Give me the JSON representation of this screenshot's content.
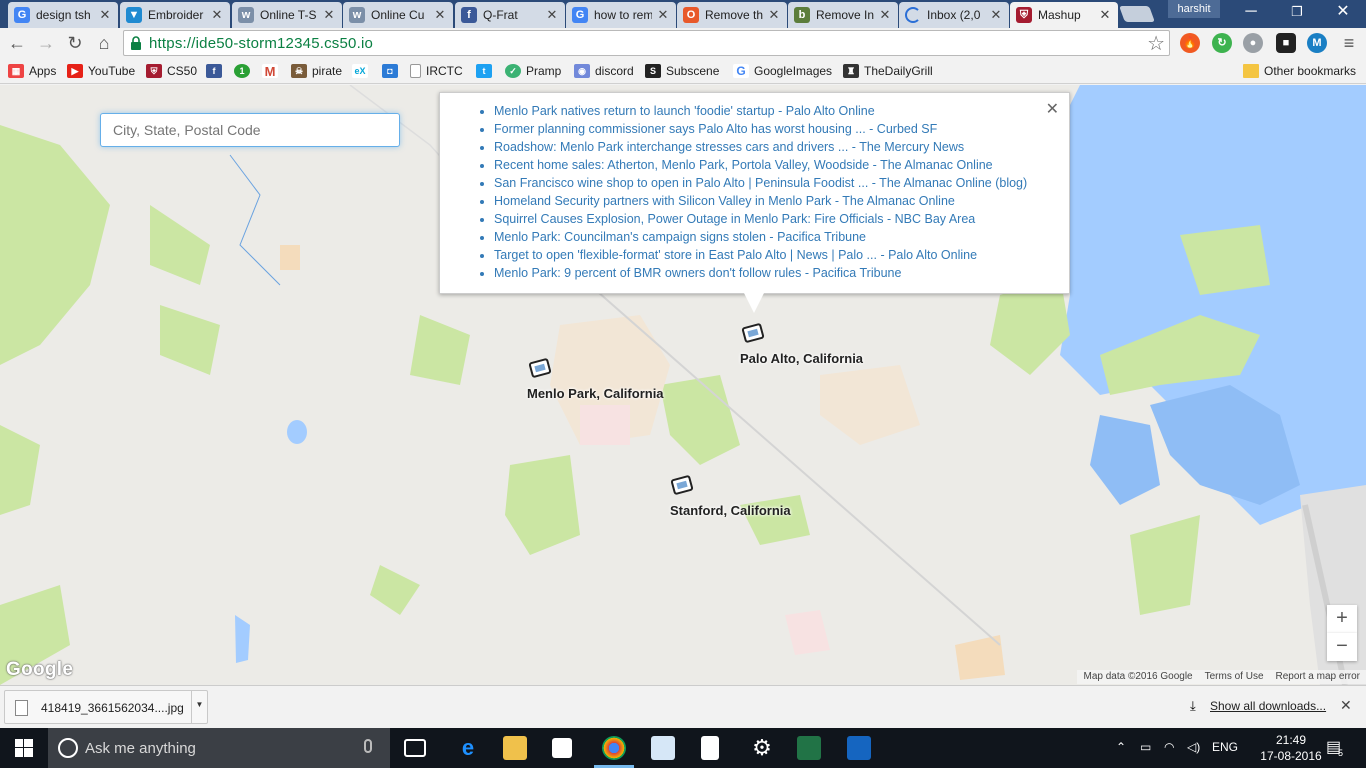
{
  "browser": {
    "tabs": [
      {
        "label": "design tsh",
        "icon": "google-icon",
        "color": "#4285f4"
      },
      {
        "label": "Embroider",
        "icon": "vistaprint-icon",
        "color": "#1f8ad1"
      },
      {
        "label": "Online T-S",
        "icon": "shirt-site-icon",
        "color": "#7b8fa8"
      },
      {
        "label": "Online Cu",
        "icon": "shirt-site-icon",
        "color": "#7b8fa8"
      },
      {
        "label": "Q-Frat",
        "icon": "facebook-icon",
        "color": "#3b5998"
      },
      {
        "label": "how to rem",
        "icon": "google-icon",
        "color": "#4285f4"
      },
      {
        "label": "Remove th",
        "icon": "office-icon",
        "color": "#e8592a"
      },
      {
        "label": "Remove In",
        "icon": "bing-icon",
        "color": "#5c7d3b"
      },
      {
        "label": "Inbox (2,0",
        "icon": "loading-icon",
        "color": "#2b6fd6"
      },
      {
        "label": "Mashup",
        "icon": "harvard-icon",
        "color": "#a51c30"
      }
    ],
    "profile_name": "harshit",
    "url": "https://ide50-storm12345.cs50.io",
    "bookmarks": [
      {
        "label": "Apps",
        "icon": "apps-icon",
        "color": "#e44"
      },
      {
        "label": "YouTube",
        "icon": "youtube-icon",
        "color": "#e62117"
      },
      {
        "label": "CS50",
        "icon": "harvard-icon",
        "color": "#a51c30"
      },
      {
        "label": "",
        "icon": "facebook-icon",
        "color": "#3b5998"
      },
      {
        "label": "",
        "icon": "one-icon",
        "color": "#2aa035"
      },
      {
        "label": "",
        "icon": "gmail-icon",
        "color": "#d14836"
      },
      {
        "label": "pirate",
        "icon": "pirate-icon",
        "color": "#7a5c3a"
      },
      {
        "label": "",
        "icon": "edx-icon",
        "color": "#02a6d8"
      },
      {
        "label": "",
        "icon": "bookmark-icon",
        "color": "#2c7bd6"
      },
      {
        "label": "IRCTC",
        "icon": "page-icon",
        "color": "#999"
      },
      {
        "label": "",
        "icon": "twitter-icon",
        "color": "#1da1f2"
      },
      {
        "label": "Pramp",
        "icon": "pramp-icon",
        "color": "#3bb273"
      },
      {
        "label": "discord",
        "icon": "discord-icon",
        "color": "#7289da"
      },
      {
        "label": "Subscene",
        "icon": "subscene-icon",
        "color": "#222"
      },
      {
        "label": "GoogleImages",
        "icon": "google-icon",
        "color": "#4285f4"
      },
      {
        "label": "TheDailyGrill",
        "icon": "grill-icon",
        "color": "#333"
      }
    ],
    "other_bookmarks": "Other bookmarks"
  },
  "map": {
    "search_placeholder": "City, State, Postal Code",
    "news_items": [
      "Menlo Park natives return to launch 'foodie' startup - Palo Alto Online",
      "Former planning commissioner says Palo Alto has worst housing ... - Curbed SF",
      "Roadshow: Menlo Park interchange stresses cars and drivers ... - The Mercury News",
      "Recent home sales: Atherton, Menlo Park, Portola Valley, Woodside - The Almanac Online",
      "San Francisco wine shop to open in Palo Alto | Peninsula Foodist ... - The Almanac Online (blog)",
      "Homeland Security partners with Silicon Valley in Menlo Park - The Almanac Online",
      "Squirrel Causes Explosion, Power Outage in Menlo Park: Fire Officials - NBC Bay Area",
      "Menlo Park: Councilman's campaign signs stolen - Pacifica Tribune",
      "Target to open 'flexible-format' store in East Palo Alto | News | Palo ... - Palo Alto Online",
      "Menlo Park: 9 percent of BMR owners don't follow rules - Pacifica Tribune"
    ],
    "markers": [
      {
        "label": "Palo Alto, California"
      },
      {
        "label": "Menlo Park, California"
      },
      {
        "label": "Stanford, California"
      }
    ],
    "zoom_in": "+",
    "zoom_out": "−",
    "logo": "Google",
    "attribution": [
      "Map data ©2016 Google",
      "Terms of Use",
      "Report a map error"
    ],
    "water_color": "#a3ccff",
    "park_color": "#cbe6a3"
  },
  "downloads": {
    "file_name": "418419_3661562034....jpg",
    "show_all": "Show all downloads..."
  },
  "taskbar": {
    "search_text": "Ask me anything",
    "language": "ENG",
    "time": "21:49",
    "date": "17-08-2016",
    "notification_count": "5"
  }
}
